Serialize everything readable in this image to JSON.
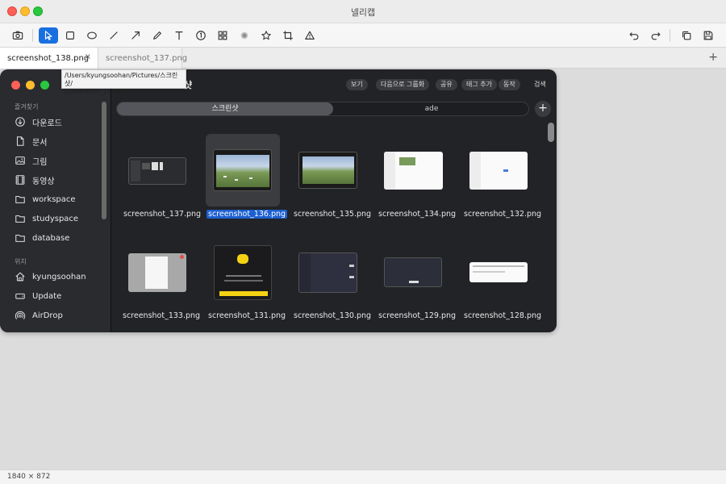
{
  "window": {
    "title": "넬리캡"
  },
  "toolbar": {
    "tools": [
      "camera-icon",
      "select-arrow-icon",
      "rectangle-icon",
      "ellipse-icon",
      "line-icon",
      "arrow-icon",
      "pen-icon",
      "text-icon",
      "step-number-icon",
      "mosaic-icon",
      "blur-icon",
      "star-icon",
      "crop-icon",
      "warning-icon"
    ],
    "right_tools": [
      "undo-icon",
      "redo-icon",
      "copy-icon",
      "save-icon"
    ]
  },
  "tabs": [
    {
      "label": "screenshot_138.png",
      "close": "×"
    },
    {
      "label": "screenshot_137.png"
    }
  ],
  "tab_add": "+",
  "tooltip": {
    "line1": "/Users/kyungsoohan/Pictures/스크린샷/",
    "line2": "screenshot_138.png"
  },
  "status": {
    "dimensions": "1840 × 872"
  },
  "finder": {
    "title_fragment": "샷",
    "toolbar_buttons": [
      "보기",
      "다음으로 그룹화",
      "공유",
      "태그 추가",
      "동작",
      "검색"
    ],
    "favorites_heading": "즐겨찾기",
    "favorites": [
      "다운로드",
      "문서",
      "그림",
      "동영상",
      "workspace",
      "studyspace",
      "database"
    ],
    "locations_heading": "위치",
    "locations": [
      "kyungsoohan",
      "Update",
      "AirDrop"
    ],
    "tabs": [
      "스크린샷",
      "ade"
    ],
    "add": "+",
    "files": [
      "screenshot_137.png",
      "screenshot_136.png",
      "screenshot_135.png",
      "screenshot_134.png",
      "screenshot_132.png",
      "screenshot_133.png",
      "screenshot_131.png",
      "screenshot_130.png",
      "screenshot_129.png",
      "screenshot_128.png"
    ],
    "selected_file": "screenshot_136.png"
  },
  "colors": {
    "accent": "#1a6fe0",
    "selection": "#1c5fd1",
    "dark_bg": "#222326"
  }
}
